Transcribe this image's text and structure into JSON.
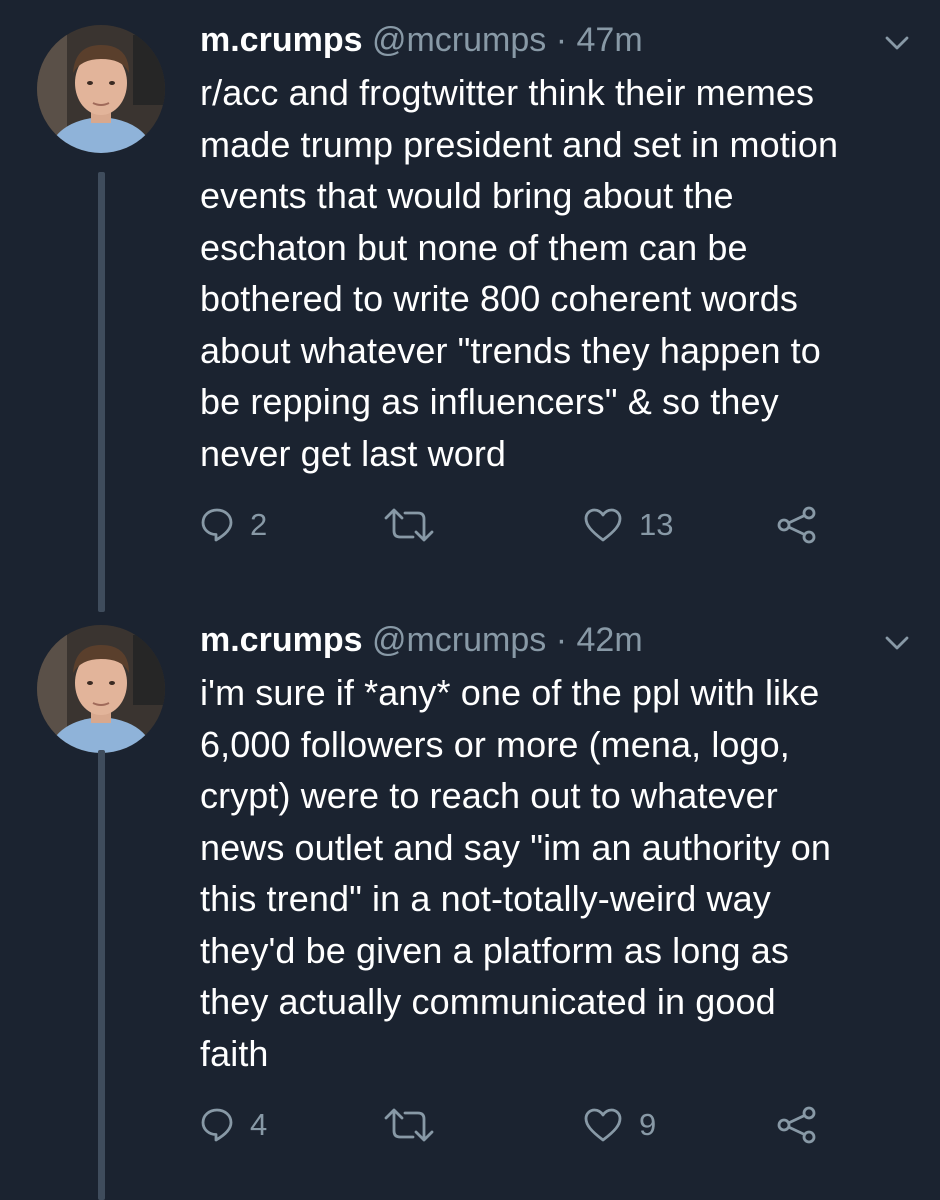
{
  "colors": {
    "background": "#1b2330",
    "text": "#ffffff",
    "secondary": "#8899a6",
    "thread_line": "#3f4c5c"
  },
  "tweets": [
    {
      "name": "m.crumps",
      "handle": "@mcrumps",
      "separator": "·",
      "time": "47m",
      "text": "r/acc and frogtwitter think their memes\nmade trump president and set in motion\nevents that would bring about the\neschaton but none of them can be\nbothered to write 800 coherent words\nabout whatever \"trends they happen to\nbe repping as influencers\" & so they\nnever get last word",
      "replies": "2",
      "likes": "13",
      "icons": [
        "reply-icon",
        "retweet-icon",
        "like-icon",
        "share-icon",
        "chevron-down-icon"
      ]
    },
    {
      "name": "m.crumps",
      "handle": "@mcrumps",
      "separator": "·",
      "time": "42m",
      "text": "i'm sure if *any* one of the ppl with like\n6,000 followers or more (mena, logo,\ncrypt) were to reach out to whatever\nnews outlet and say \"im an authority on\nthis trend\" in a not-totally-weird way\nthey'd be given a platform as long as\nthey actually communicated in good\nfaith",
      "replies": "4",
      "likes": "9",
      "icons": [
        "reply-icon",
        "retweet-icon",
        "like-icon",
        "share-icon",
        "chevron-down-icon"
      ]
    }
  ]
}
